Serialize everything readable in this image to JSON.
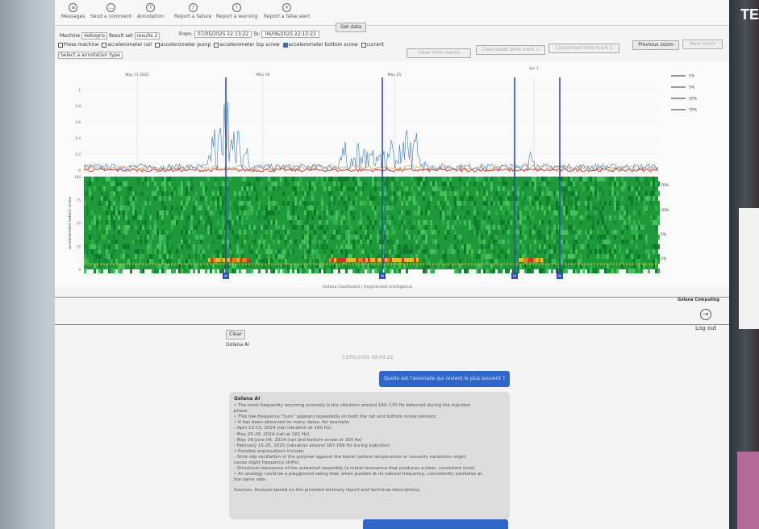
{
  "toolbar": {
    "items": [
      {
        "label": "Messages",
        "icon": "messages-icon"
      },
      {
        "label": "Send a comment",
        "icon": "comment-icon"
      },
      {
        "label": "Annotation",
        "icon": "help-icon"
      },
      {
        "label": "Report a failure",
        "icon": "failure-icon"
      },
      {
        "label": "Report a warning",
        "icon": "warning-icon"
      },
      {
        "label": "Report a false alert",
        "icon": "false-alert-icon"
      }
    ]
  },
  "controls": {
    "machine_label": "Machine",
    "machine_value": "debogris",
    "result_label": "Result set",
    "result_value": "results 2",
    "from_label": "From",
    "from_value": "07/05/2025 22:13:22",
    "to_label": "To",
    "to_value": "06/06/2025 22:13:22",
    "get_data": "Get data",
    "press_machine": "Press machine",
    "checkboxes": [
      {
        "label": "accelerometer rail",
        "checked": false
      },
      {
        "label": "accelerometer pump",
        "checked": false
      },
      {
        "label": "accelerometer top screw",
        "checked": false
      },
      {
        "label": "accelerometer bottom screw",
        "checked": true
      },
      {
        "label": "current",
        "checked": false
      }
    ],
    "annotation_placeholder": "Select a annotation type",
    "clear_time_marks": "Clear time marks",
    "clear_time_mark_1": "Clear/reset time mark 1",
    "clear_time_mark_2": "Clear/reset time mark 2",
    "previous_zoom": "Previous zoom",
    "next_zoom": "Next zoom"
  },
  "chart_data": {
    "type": "line",
    "x_markers": [
      "May 11 2025",
      "May 18",
      "May 25",
      "Jun 1"
    ],
    "ylabel_heatmap": "accelerometer bottom screw",
    "line_yticks": [
      "0",
      "0.2",
      "0.4",
      "0.6",
      "0.8",
      "1"
    ],
    "heatmap_yticks": [
      "0",
      "25",
      "50",
      "75",
      "100"
    ],
    "legend": [
      "1%",
      "5%",
      "20%",
      "70%"
    ],
    "heatmap_right_labels": [
      "70%",
      "20%",
      "5%",
      "1%"
    ],
    "marks": [
      "M",
      "M",
      "M",
      "M"
    ],
    "colors": {
      "series_blue": "#3a78b8",
      "series_orange": "#d98a2b",
      "series_red": "#c0392b",
      "heat_green": "#1e9a3a",
      "marker_blue": "#2b4fb0"
    }
  },
  "footer": {
    "caption": "Golana Dashboard | Augmented Intelligence",
    "company": "Golana Computing",
    "logout": "Log out",
    "clear": "Clear",
    "bot_name": "Golana AI",
    "timestamp": "13/05/2025 09:43:22"
  },
  "chat": {
    "question": "Quelle est l'anomalie qui revient le plus souvent ?",
    "answer_title": "Golana AI",
    "answer_lines": [
      "• The most frequently recurring anomaly is the vibration around 160–170 Hz detected during the injection",
      "phase.",
      "• This low-frequency \"hum\" appears repeatedly on both the rail and bottom screw sensors.",
      "• It has been observed on many dates, for example:",
      "   - April 13-15, 2024 (rail vibration at 160 Hz)",
      "   - May 25-29, 2024 (rail at 161 Hz)",
      "   - May 29-June 04, 2024 (rail and bottom screw at 169 Hz)",
      "   - February 15-25, 2025 (vibration around 167-169 Hz during injection)",
      "• Possible explanations include:",
      "   - Stick-slip oscillation of the polymer against the barrel (where temperature or viscosity variations might",
      "cause slight frequency shifts)",
      "   - Structural resonance of the screw/rail assembly (a metal resonance that produces a clear, consistent tone)",
      "• An analogy could be a playground swing that, when pushed at its natural frequency, consistently oscillates at",
      "the same rate."
    ],
    "sources": "Sources: Analysis based on the provided anomaly report and technical descriptions."
  }
}
